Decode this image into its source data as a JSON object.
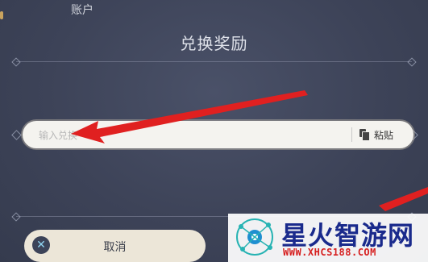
{
  "header": {
    "account_tab": "账户"
  },
  "dialog": {
    "title": "兑换奖励",
    "input": {
      "placeholder": "输入兑换",
      "value": ""
    },
    "paste_label": "粘贴",
    "cancel_label": "取消"
  },
  "watermark": {
    "title": "星火智游网",
    "url": "WWW.XHCS188.COM"
  },
  "colors": {
    "arrow": "#e02020",
    "background": "#3d4358",
    "input": "#f4f3ef"
  },
  "icons": [
    "copy-icon",
    "cancel-x-icon",
    "network-logo-icon"
  ]
}
